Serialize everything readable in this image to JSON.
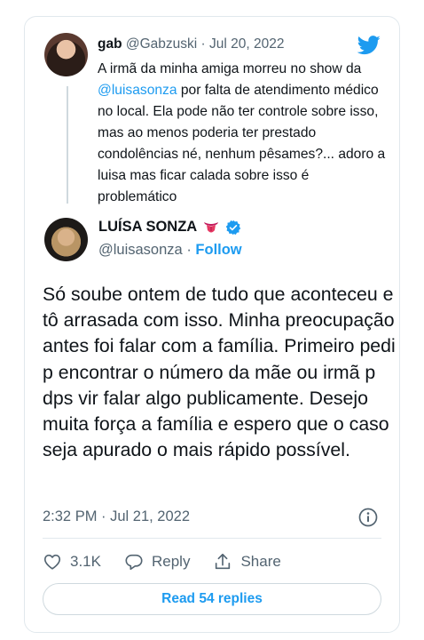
{
  "quoted_tweet": {
    "display_name": "gab",
    "handle": "@Gabzuski",
    "separator": "·",
    "date": "Jul 20, 2022",
    "text_pre": "A irmã da minha amiga morreu no show da ",
    "mention": "@luisasonza",
    "text_post": " por falta de atendimento médico no local. Ela pode não ter controle sobre isso, mas ao menos poderia ter prestado condolências né, nenhum pêsames?... adoro a luisa mas ficar calada sobre isso é problemático",
    "avatar_icon": "avatar-photo"
  },
  "tweet": {
    "display_name": "LUÍSA SONZA",
    "name_emoji": "tongue-emoji",
    "verified_icon": "verified-badge-icon",
    "handle": "@luisasonza",
    "separator": "·",
    "follow_label": "Follow",
    "text": "Só soube ontem de tudo que aconteceu e tô arrasada com isso. Minha preocupação antes foi falar com a família. Primeiro pedi p encontrar o número da mãe ou irmã p dps vir falar algo publicamente. Desejo muita força a família e espero que o caso seja apurado o mais rápido possível.",
    "timestamp": "2:32 PM · Jul 21, 2022"
  },
  "actions": {
    "like_count": "3.1K",
    "reply_label": "Reply",
    "share_label": "Share"
  },
  "read_replies_label": "Read 54 replies",
  "colors": {
    "accent": "#1d9bf0",
    "text": "#0f1419",
    "muted": "#536471",
    "border": "#e1e8ed"
  }
}
